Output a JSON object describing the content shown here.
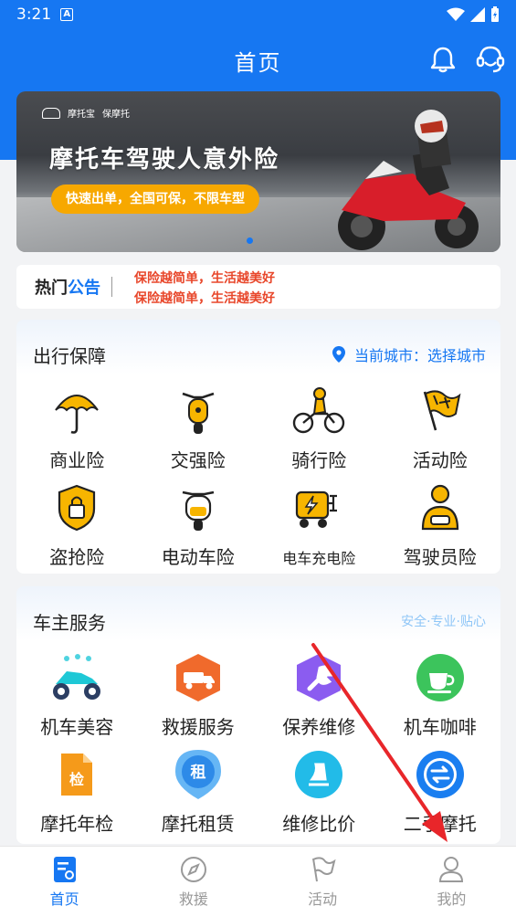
{
  "status": {
    "time": "3:21",
    "app_badge": "A"
  },
  "nav": {
    "title": "首页"
  },
  "banner": {
    "brand_name": "摩托宝",
    "brand_sub": "保摩托",
    "headline": "摩托车驾驶人意外险",
    "pill": "快速出单，全国可保，不限车型"
  },
  "notice": {
    "hot_a": "热门",
    "hot_b": "公告",
    "line1": "保险越简单，生活越美好",
    "line2": "保险越简单，生活越美好"
  },
  "travel": {
    "title": "出行保障",
    "city_label": "当前城市：选择城市",
    "items": [
      {
        "label": "商业险",
        "icon": "umbrella-icon"
      },
      {
        "label": "交强险",
        "icon": "scooter-icon"
      },
      {
        "label": "骑行险",
        "icon": "rider-icon"
      },
      {
        "label": "活动险",
        "icon": "flag-icon"
      },
      {
        "label": "盗抢险",
        "icon": "shield-lock-icon"
      },
      {
        "label": "电动车险",
        "icon": "ebike-icon"
      },
      {
        "label": "电车充电险",
        "icon": "charging-icon"
      },
      {
        "label": "驾驶员险",
        "icon": "driver-icon"
      }
    ]
  },
  "owner": {
    "title": "车主服务",
    "tagline": "安全·专业·贴心",
    "items": [
      {
        "label": "机车美容",
        "icon": "moto-wash-icon"
      },
      {
        "label": "救援服务",
        "icon": "tow-truck-icon"
      },
      {
        "label": "保养维修",
        "icon": "wrench-icon"
      },
      {
        "label": "机车咖啡",
        "icon": "coffee-icon"
      },
      {
        "label": "摩托年检",
        "icon": "inspection-icon"
      },
      {
        "label": "摩托租赁",
        "icon": "rent-icon"
      },
      {
        "label": "维修比价",
        "icon": "compare-icon"
      },
      {
        "label": "二手摩托",
        "icon": "used-moto-icon"
      }
    ]
  },
  "tabs": [
    {
      "label": "首页",
      "icon": "home-icon"
    },
    {
      "label": "救援",
      "icon": "compass-icon"
    },
    {
      "label": "活动",
      "icon": "flag-icon"
    },
    {
      "label": "我的",
      "icon": "user-icon"
    }
  ],
  "colors": {
    "primary": "#1677f2",
    "accent_yellow": "#f7b500",
    "notice_red": "#e8472b",
    "annotation": "#e8262a"
  }
}
